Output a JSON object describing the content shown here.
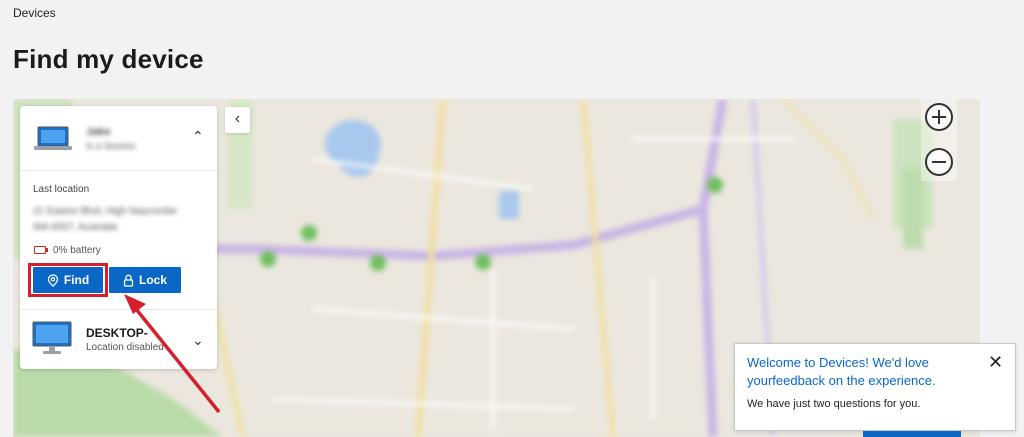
{
  "breadcrumb": "Devices",
  "page_title": "Find my device",
  "map": {
    "zoom_in_label": "+",
    "zoom_out_label": "−"
  },
  "panel": {
    "collapse_glyph": "‹",
    "device1": {
      "name": "Jake",
      "subtitle": "In a Session",
      "expand_glyph": "⌃"
    },
    "last_location_label": "Last location",
    "address_line1": "21 Easton Blvd, High Naycombe",
    "address_line2": "WA 6057, Australia",
    "battery": "0% battery",
    "find_label": "Find",
    "lock_label": "Lock",
    "device2": {
      "name": "DESKTOP-",
      "subtitle": "Location disabled",
      "expand_glyph": "⌄"
    }
  },
  "toast": {
    "title": "Welcome to Devices! We'd love yourfeedback on the experience.",
    "body": "We have just two questions for you.",
    "close_glyph": "✕"
  },
  "colors": {
    "accent": "#0a67c6",
    "highlight": "#d41f2c",
    "battery_low": "#d52b1e"
  }
}
